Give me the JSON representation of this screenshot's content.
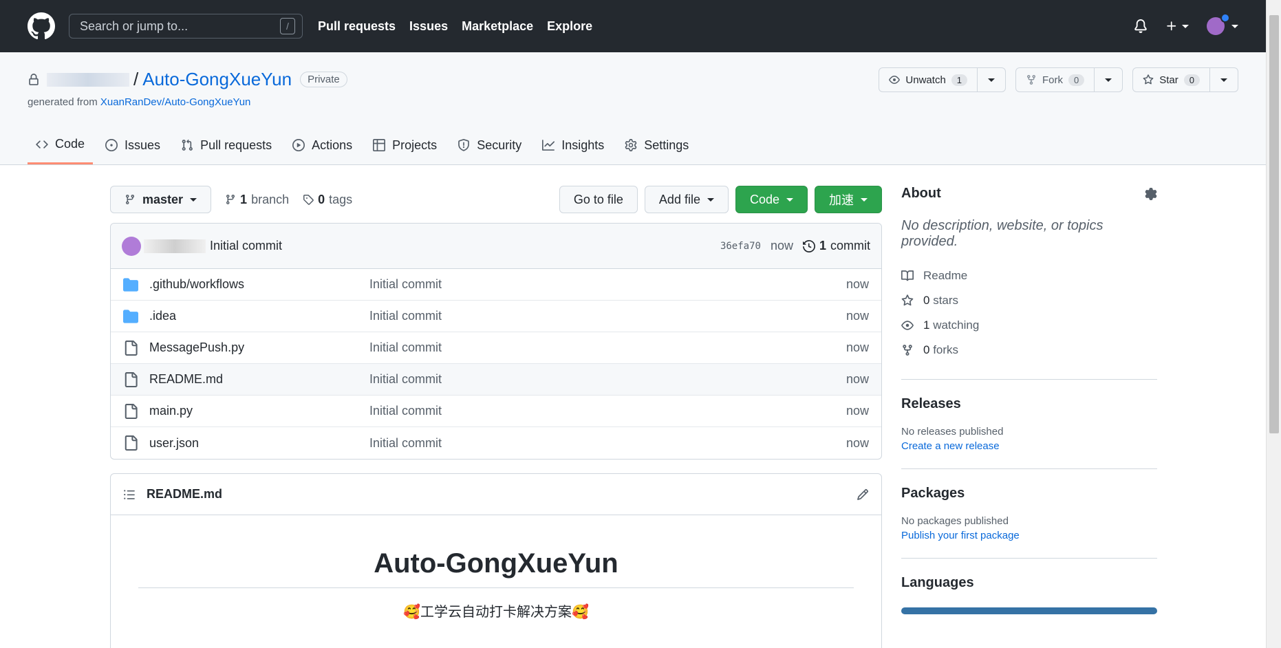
{
  "header": {
    "search_placeholder": "Search or jump to...",
    "slash_key": "/",
    "nav": [
      "Pull requests",
      "Issues",
      "Marketplace",
      "Explore"
    ]
  },
  "repo": {
    "separator": "/",
    "name": "Auto-GongXueYun",
    "visibility": "Private",
    "generated_prefix": "generated from",
    "generated_link": "XuanRanDev/Auto-GongXueYun",
    "watch": {
      "label": "Unwatch",
      "count": "1"
    },
    "fork": {
      "label": "Fork",
      "count": "0"
    },
    "star": {
      "label": "Star",
      "count": "0"
    }
  },
  "tabs": [
    "Code",
    "Issues",
    "Pull requests",
    "Actions",
    "Projects",
    "Security",
    "Insights",
    "Settings"
  ],
  "branch": {
    "current": "master",
    "branch_count": "1",
    "branch_label": "branch",
    "tag_count": "0",
    "tag_label": "tags",
    "go_to_file": "Go to file",
    "add_file": "Add file",
    "code": "Code",
    "accelerate": "加速"
  },
  "commit": {
    "message": "Initial commit",
    "sha": "36efa70",
    "time": "now",
    "count": "1",
    "count_label": "commit"
  },
  "files": [
    {
      "name": ".github/workflows",
      "type": "folder",
      "message": "Initial commit",
      "time": "now"
    },
    {
      "name": ".idea",
      "type": "folder",
      "message": "Initial commit",
      "time": "now"
    },
    {
      "name": "MessagePush.py",
      "type": "file",
      "message": "Initial commit",
      "time": "now"
    },
    {
      "name": "README.md",
      "type": "file",
      "message": "Initial commit",
      "time": "now"
    },
    {
      "name": "main.py",
      "type": "file",
      "message": "Initial commit",
      "time": "now"
    },
    {
      "name": "user.json",
      "type": "file",
      "message": "Initial commit",
      "time": "now"
    }
  ],
  "readme": {
    "filename": "README.md",
    "title": "Auto-GongXueYun",
    "subtitle": "🥰工学云自动打卡解决方案🥰"
  },
  "about": {
    "title": "About",
    "description": "No description, website, or topics provided.",
    "readme": "Readme",
    "stars_count": "0",
    "stars_label": "stars",
    "watching_count": "1",
    "watching_label": "watching",
    "forks_count": "0",
    "forks_label": "forks"
  },
  "releases": {
    "title": "Releases",
    "empty": "No releases published",
    "link": "Create a new release"
  },
  "packages": {
    "title": "Packages",
    "empty": "No packages published",
    "link": "Publish your first package"
  },
  "languages": {
    "title": "Languages",
    "bar_color": "#3572a5"
  }
}
